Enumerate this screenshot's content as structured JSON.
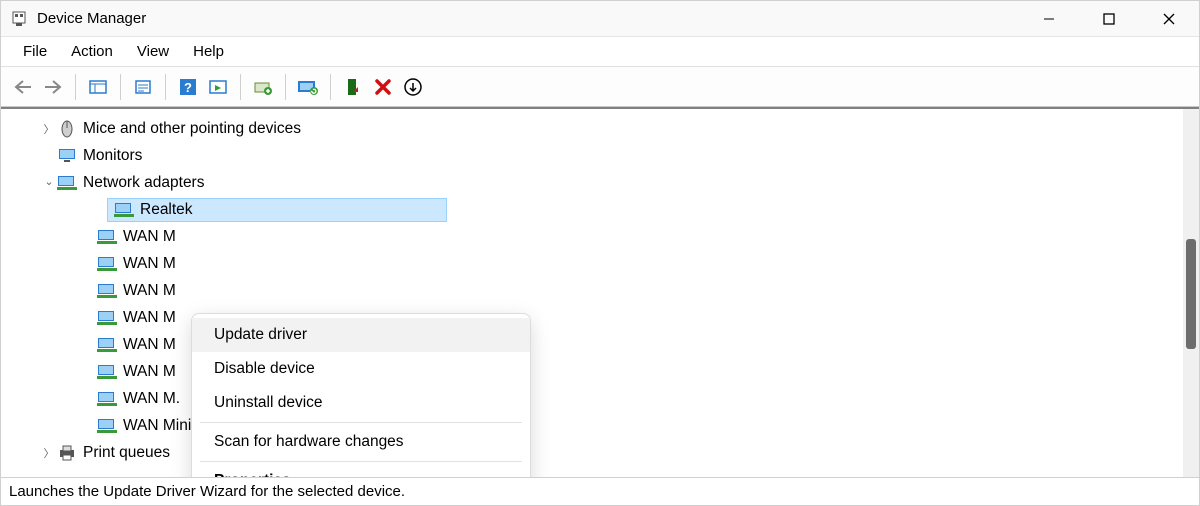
{
  "window": {
    "title": "Device Manager"
  },
  "menubar": {
    "file": "File",
    "action": "Action",
    "view": "View",
    "help": "Help"
  },
  "toolbar": {
    "back": "Back",
    "forward": "Forward",
    "show_hide_tree": "Show/Hide Console Tree",
    "properties": "Properties",
    "help": "Help",
    "update_driver": "Update Device Driver",
    "disable": "Disable Device",
    "uninstall": "Uninstall Device",
    "scan": "Scan for hardware changes",
    "add_legacy": "Add legacy hardware"
  },
  "tree": {
    "mice": {
      "label": "Mice and other pointing devices",
      "expanded": false
    },
    "monitors": {
      "label": "Monitors",
      "expanded": false
    },
    "network": {
      "label": "Network adapters",
      "expanded": true,
      "children": {
        "realtek": "Realtek",
        "wan1": "WAN M",
        "wan2": "WAN M",
        "wan3": "WAN M",
        "wan4": "WAN M",
        "wan5": "WAN M",
        "wan6": "WAN M",
        "wan7": "WAN M.",
        "wan8": "WAN Miniport (SSTP)"
      }
    },
    "print": {
      "label": "Print queues",
      "expanded": false
    }
  },
  "context_menu": {
    "update": "Update driver",
    "disable": "Disable device",
    "uninstall": "Uninstall device",
    "scan": "Scan for hardware changes",
    "properties": "Properties"
  },
  "statusbar": {
    "text": "Launches the Update Driver Wizard for the selected device."
  }
}
